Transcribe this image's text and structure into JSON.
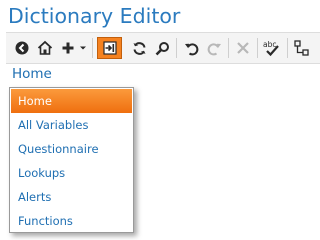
{
  "app": {
    "title": "Dictionary Editor"
  },
  "toolbar": {
    "buttons": [
      {
        "icon": "back-icon"
      },
      {
        "icon": "home-icon"
      },
      {
        "icon": "add-icon"
      },
      {
        "icon": "add-dropdown-chevron-icon"
      },
      {
        "icon": "import-icon"
      },
      {
        "icon": "refresh-icon"
      },
      {
        "icon": "search-icon"
      },
      {
        "icon": "undo-icon"
      },
      {
        "icon": "redo-icon"
      },
      {
        "icon": "delete-icon"
      },
      {
        "icon": "spellcheck-icon",
        "glyph": "abc"
      },
      {
        "icon": "tree-structure-icon"
      }
    ]
  },
  "breadcrumb": {
    "label": "Home"
  },
  "menu": {
    "items": [
      {
        "label": "Home",
        "selected": true
      },
      {
        "label": "All Variables"
      },
      {
        "label": "Questionnaire"
      },
      {
        "label": "Lookups"
      },
      {
        "label": "Alerts"
      },
      {
        "label": "Functions"
      }
    ]
  },
  "colors": {
    "title": "#2b7bbf",
    "link": "#1f6fb2",
    "accent": "#f58220",
    "selected_text": "#ffffff"
  }
}
